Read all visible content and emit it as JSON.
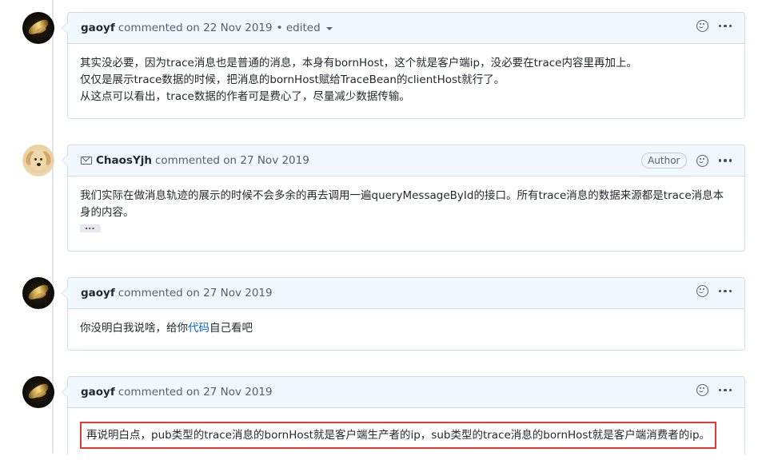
{
  "comments": [
    {
      "author": "gaoyf",
      "meta": "commented on 22 Nov 2019",
      "edited": "• edited",
      "avatar": "gold-bird-avatar",
      "lines": [
        "其实没必要，因为trace消息也是普通的消息，本身有bornHost，这个就是客户端ip，没必要在trace内容里再加上。",
        "仅仅是展示trace数据的时候，把消息的bornHost赋给TraceBean的clientHost就行了。",
        "从这点可以看出，trace数据的作者可是费心了，尽量减少数据传输。"
      ]
    },
    {
      "author": "ChaosYjh",
      "meta": "commented on 27 Nov 2019",
      "badge": "Author",
      "avatar": "dog-avatar",
      "lines": [
        "我们实际在做消息轨迹的展示的时候不会多余的再去调用一遍queryMessageById的接口。所有trace消息的数据来源都是trace消息本",
        "身的内容。"
      ]
    },
    {
      "author": "gaoyf",
      "meta": "commented on 27 Nov 2019",
      "avatar": "gold-bird-avatar",
      "text_before_link": "你没明白我说啥，给你",
      "link": "代码",
      "text_after_link": "自己看吧"
    },
    {
      "author": "gaoyf",
      "meta": "commented on 27 Nov 2019",
      "avatar": "gold-bird-avatar",
      "lines": [
        "再说明白点，pub类型的trace消息的bornHost就是客户端生产者的ip，sub类型的trace消息的bornHost就是客户端消费者的ip。"
      ]
    }
  ],
  "colors": {
    "header_bg": "#f1f8ff",
    "border": "#d1dbe5",
    "link": "#0366d6",
    "highlight": "#e53935"
  }
}
